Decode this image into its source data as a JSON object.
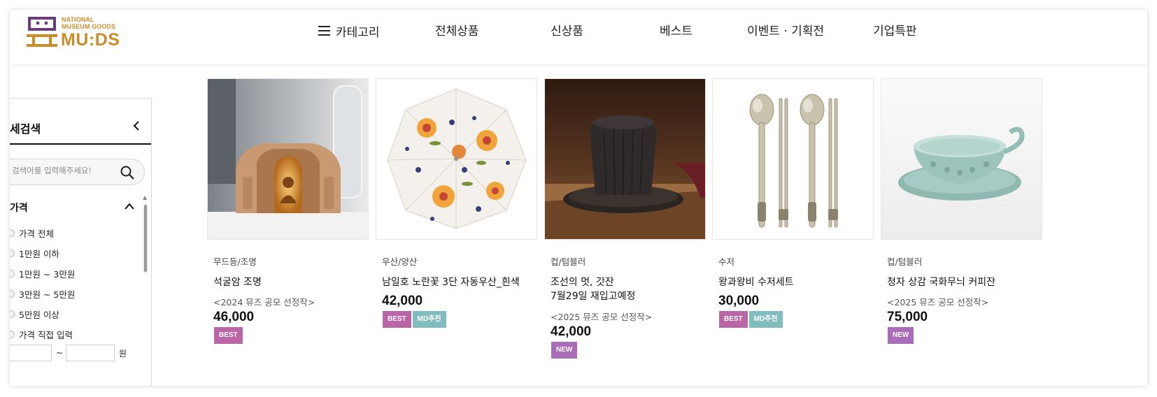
{
  "brand": {
    "logo_small_line1": "NATIONAL",
    "logo_small_line2": "MUSEUM GOODS",
    "logo_big": "MU:DS",
    "accent_color": "#c98e2a",
    "mark_color": "#6b3d7a"
  },
  "nav": {
    "category": "카테고리",
    "all_products": "전체상품",
    "new_products": "신상품",
    "best": "베스트",
    "events": "이벤트 · 기획전",
    "corporate": "기업특판"
  },
  "sidebar": {
    "title": "세검색",
    "search_placeholder": "검색어를 입력해주세요!",
    "section_title": "가격",
    "price_options": [
      "가격 전체",
      "1만원 이하",
      "1만원 ~ 3만원",
      "3만원 ~ 5만원",
      "5만원 이상",
      "가격 직접 입력"
    ],
    "range_separator": "~",
    "range_unit": "원"
  },
  "products": [
    {
      "category": "무드등/조명",
      "name": "석굴암 조명",
      "name_line2": "",
      "note": "<2024 뮤즈 공모 선정작>",
      "price": "46,000",
      "badges": [
        "BEST"
      ]
    },
    {
      "category": "우산/양산",
      "name": "남일호 노란꽃 3단 자동우산_흰색",
      "name_line2": "",
      "note": "",
      "price": "42,000",
      "badges": [
        "BEST",
        "MD추천"
      ]
    },
    {
      "category": "컵/텀블러",
      "name": "조선의 멋, 갓잔",
      "name_line2": "7월29일 재입고예정",
      "note": "<2025 뮤즈 공모 선정작>",
      "price": "42,000",
      "badges": [
        "NEW"
      ]
    },
    {
      "category": "수저",
      "name": "왕과왕비 수저세트",
      "name_line2": "",
      "note": "",
      "price": "30,000",
      "badges": [
        "BEST",
        "MD추천"
      ]
    },
    {
      "category": "컵/텀블러",
      "name": "청자 상감 국화무늬 커피잔",
      "name_line2": "",
      "note": "<2025 뮤즈 공모 선정작>",
      "price": "75,000",
      "badges": [
        "NEW"
      ]
    }
  ],
  "badge_colors": {
    "BEST": "#b965a6",
    "MD추천": "#81bcbf",
    "NEW": "#a96cb8"
  }
}
